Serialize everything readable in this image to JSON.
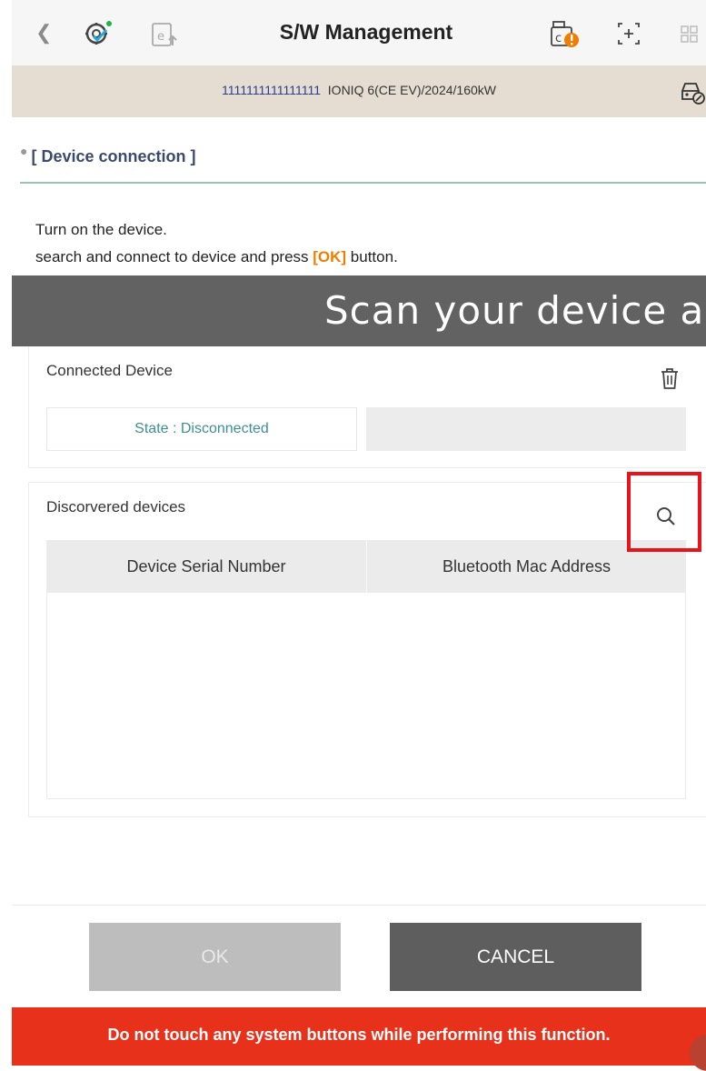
{
  "toolbar": {
    "back_icon": "chevron-left-icon",
    "title": "S/W Management"
  },
  "vehicle": {
    "vin": "1111111111111111",
    "model": "IONIQ 6(CE EV)/2024/160kW"
  },
  "section": {
    "title": "[ Device connection ]",
    "instruction_line1": "Turn on the device.",
    "instruction_line2_before": "search and connect to device and press ",
    "instruction_ok": "[OK]",
    "instruction_line2_after": " button."
  },
  "banner": {
    "text": "Scan your device an"
  },
  "connected": {
    "title": "Connected Device",
    "state": "State : Disconnected"
  },
  "discovered": {
    "title": "Discorvered devices",
    "columns": [
      "Device Serial Number",
      "Bluetooth Mac Address"
    ],
    "rows": []
  },
  "buttons": {
    "ok": "OK",
    "cancel": "CANCEL"
  },
  "warning": {
    "text": "Do not touch any system buttons while performing this function."
  },
  "colors": {
    "accent_orange": "#f07d00",
    "state_teal": "#3f8f92",
    "warning_red": "#e8311a",
    "highlight_red": "#e8131b"
  }
}
